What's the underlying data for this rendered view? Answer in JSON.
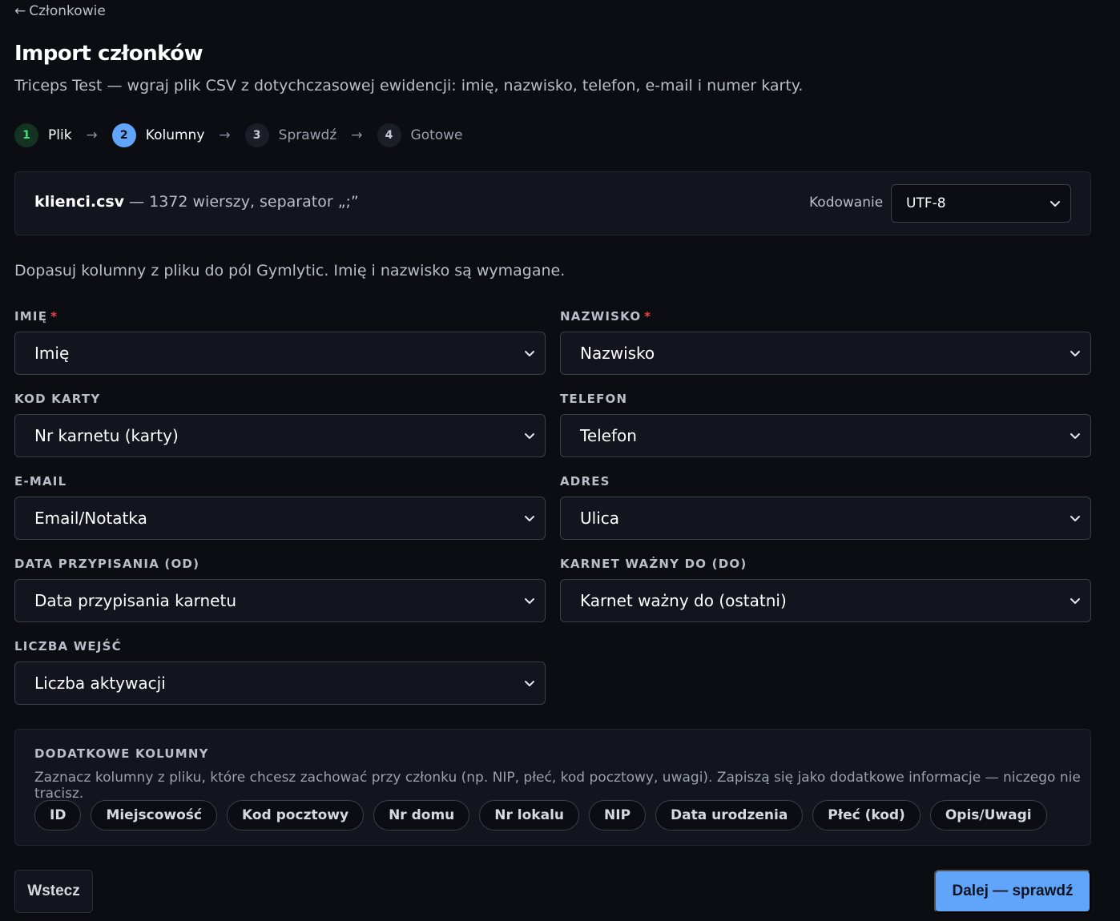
{
  "nav": {
    "back_arrow": "←",
    "back_label": "Członkowie"
  },
  "header": {
    "title": "Import członków",
    "subtitle": "Triceps Test — wgraj plik CSV z dotychczasowej ewidencji: imię, nazwisko, telefon, e-mail i numer karty."
  },
  "steps": [
    {
      "num": "1",
      "label": "Plik",
      "state": "done"
    },
    {
      "num": "2",
      "label": "Kolumny",
      "state": "active"
    },
    {
      "num": "3",
      "label": "Sprawdź",
      "state": "pending"
    },
    {
      "num": "4",
      "label": "Gotowe",
      "state": "pending"
    }
  ],
  "step_arrow": "→",
  "file": {
    "name": "klienci.csv",
    "details": " — 1372 wierszy, separator „;”",
    "encoding_label": "Kodowanie",
    "encoding_value": "UTF-8"
  },
  "instruction": "Dopasuj kolumny z pliku do pól Gymlytic. Imię i nazwisko są wymagane.",
  "fields": [
    {
      "label": "IMIĘ",
      "required": "*",
      "value": "Imię"
    },
    {
      "label": "NAZWISKO",
      "required": "*",
      "value": "Nazwisko"
    },
    {
      "label": "KOD KARTY",
      "value": "Nr karnetu (karty)"
    },
    {
      "label": "TELEFON",
      "value": "Telefon"
    },
    {
      "label": "E-MAIL",
      "value": "Email/Notatka"
    },
    {
      "label": "ADRES",
      "value": "Ulica"
    },
    {
      "label": "DATA PRZYPISANIA (OD)",
      "value": "Data przypisania karnetu"
    },
    {
      "label": "KARNET WAŻNY DO (DO)",
      "value": "Karnet ważny do (ostatni)"
    },
    {
      "label": "LICZBA WEJŚĆ",
      "value": "Liczba aktywacji"
    }
  ],
  "extra": {
    "title": "DODATKOWE KOLUMNY",
    "description": "Zaznacz kolumny z pliku, które chcesz zachować przy członku (np. NIP, płeć, kod pocztowy, uwagi). Zapiszą się jako dodatkowe informacje — niczego nie tracisz.",
    "chips": [
      "ID",
      "Miejscowość",
      "Kod pocztowy",
      "Nr domu",
      "Nr lokalu",
      "NIP",
      "Data urodzenia",
      "Płeć (kod)",
      "Opis/Uwagi"
    ]
  },
  "actions": {
    "back_label": "Wstecz",
    "next_label": "Dalej — sprawdź"
  },
  "colors": {
    "accent": "#60a5fa",
    "done": "#4ade80",
    "required": "#ef4444",
    "background": "#0b0d13"
  }
}
